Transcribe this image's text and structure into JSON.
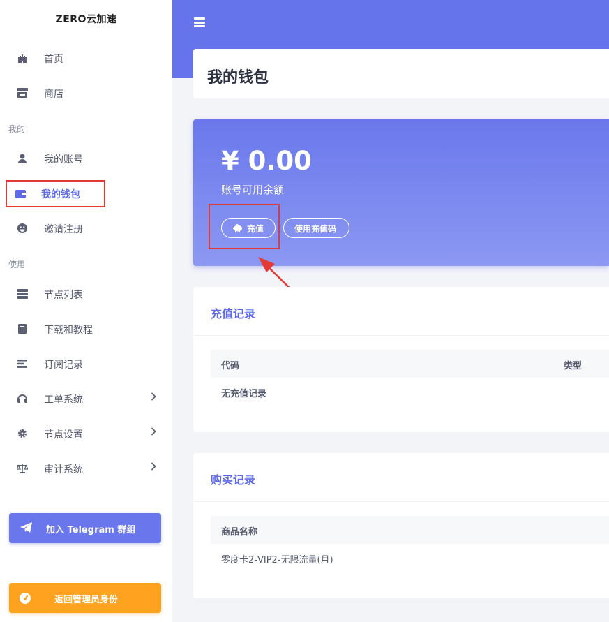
{
  "brand": "ZERO云加速",
  "sidebar": {
    "items_top": [
      {
        "label": "首页",
        "icon": "castle-icon"
      },
      {
        "label": "商店",
        "icon": "store-icon"
      }
    ],
    "section_mine": "我的",
    "items_mine": [
      {
        "label": "我的账号",
        "icon": "user-icon"
      },
      {
        "label": "我的钱包",
        "icon": "wallet-icon",
        "active": true
      },
      {
        "label": "邀请注册",
        "icon": "smile-icon"
      }
    ],
    "section_use": "使用",
    "items_use": [
      {
        "label": "节点列表",
        "icon": "server-icon"
      },
      {
        "label": "下载和教程",
        "icon": "book-icon"
      },
      {
        "label": "订阅记录",
        "icon": "list-icon"
      },
      {
        "label": "工单系统",
        "icon": "headset-icon",
        "has_submenu": true
      },
      {
        "label": "节点设置",
        "icon": "gear-icon",
        "has_submenu": true
      },
      {
        "label": "审计系统",
        "icon": "scale-icon",
        "has_submenu": true
      }
    ],
    "telegram_button": "加入 Telegram 群组",
    "admin_button": "返回管理员身份"
  },
  "page_title": "我的钱包",
  "wallet": {
    "balance": "¥ 0.00",
    "balance_label": "账号可用余额",
    "recharge_button": "充值",
    "use_code_button": "使用充值码"
  },
  "recharge_records": {
    "title": "充值记录",
    "columns": [
      "代码",
      "类型"
    ],
    "empty_text": "无充值记录"
  },
  "purchase_records": {
    "title": "购买记录",
    "columns": [
      "商品名称"
    ],
    "rows": [
      "零度卡2-VIP2-无限流量(月)"
    ]
  },
  "colors": {
    "accent": "#6674ec",
    "orange": "#ffa21f",
    "highlight_red": "#e53935"
  }
}
